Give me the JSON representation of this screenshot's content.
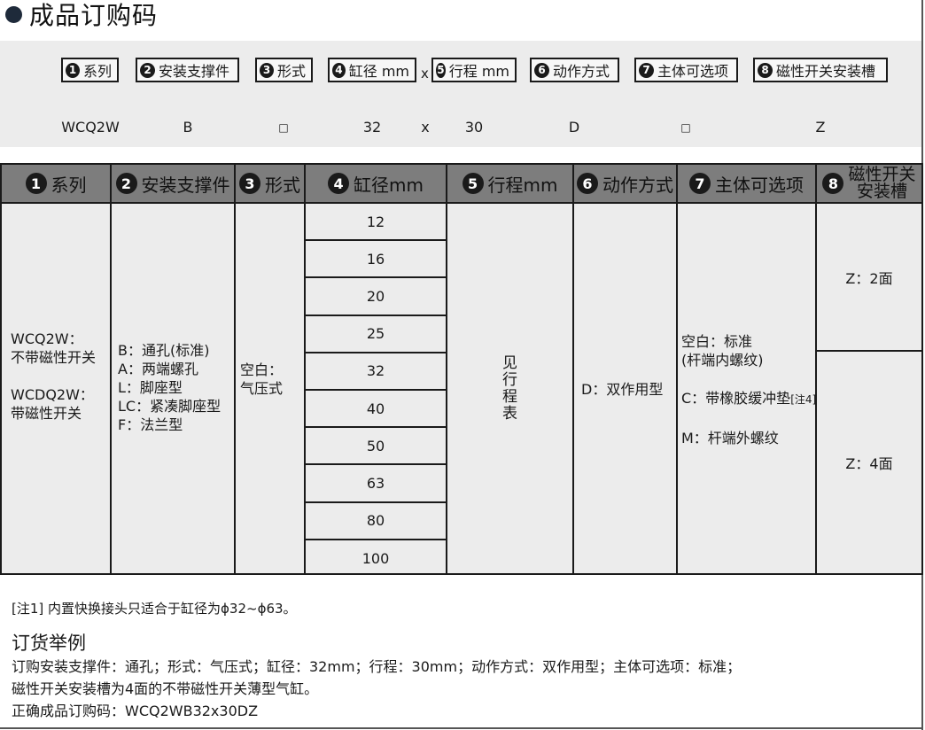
{
  "page_title": "成品订购码",
  "code_panel": {
    "boxes": [
      {
        "num": "1",
        "label": "系列"
      },
      {
        "num": "2",
        "label": "安装支撑件"
      },
      {
        "num": "3",
        "label": "形式"
      },
      {
        "num": "4",
        "label": "缸径 mm"
      },
      {
        "num": "5",
        "label": "行程 mm"
      },
      {
        "num": "6",
        "label": "动作方式"
      },
      {
        "num": "7",
        "label": "主体可选项"
      },
      {
        "num": "8",
        "label": "磁性开关安装槽"
      }
    ],
    "separator": "x",
    "example_values": {
      "series": "WCQ2W",
      "mount": "B",
      "form": "□",
      "bore": "32",
      "x": "x",
      "stroke": "30",
      "action": "D",
      "option": "□",
      "switch": "Z"
    }
  },
  "table": {
    "headers": [
      {
        "num": "1",
        "label": "系列"
      },
      {
        "num": "2",
        "label": "安装支撑件"
      },
      {
        "num": "3",
        "label": "形式"
      },
      {
        "num": "4",
        "label": "缸径mm"
      },
      {
        "num": "5",
        "label": "行程mm"
      },
      {
        "num": "6",
        "label": "动作方式"
      },
      {
        "num": "7",
        "label": "主体可选项"
      },
      {
        "num": "8",
        "label_line1": "磁性开关",
        "label_line2": "安装槽"
      }
    ],
    "series": [
      "WCQ2W：",
      "不带磁性开关",
      "WCDQ2W：",
      "带磁性开关"
    ],
    "mount": [
      "B：通孔(标准)",
      "A：两端螺孔",
      "L：脚座型",
      "LC：紧凑脚座型",
      "F：法兰型"
    ],
    "form": [
      "空白：",
      "气压式"
    ],
    "bores": [
      "12",
      "16",
      "20",
      "25",
      "32",
      "40",
      "50",
      "63",
      "80",
      "100"
    ],
    "stroke": "见行程表",
    "action": "D：双作用型",
    "options": {
      "line1": "空白：标准",
      "line2": "(杆端内螺纹)",
      "line3": "C：带橡胶缓冲垫",
      "line3_note": "[注4]",
      "line4": "M：杆端外螺纹"
    },
    "switch": [
      "Z：2面",
      "Z：4面"
    ]
  },
  "note1": "[注1] 内置快换接头只适合于缸径为ϕ32~ϕ63。",
  "example": {
    "title": "订货举例",
    "line1": "订购安装支撑件：通孔；形式：气压式；缸径：32mm；行程：30mm；动作方式：双作用型；主体可选项：标准；",
    "line2": "磁性开关安装槽为4面的不带磁性开关薄型气缸。",
    "line3": "正确成品订购码：WCQ2WB32x30DZ"
  }
}
